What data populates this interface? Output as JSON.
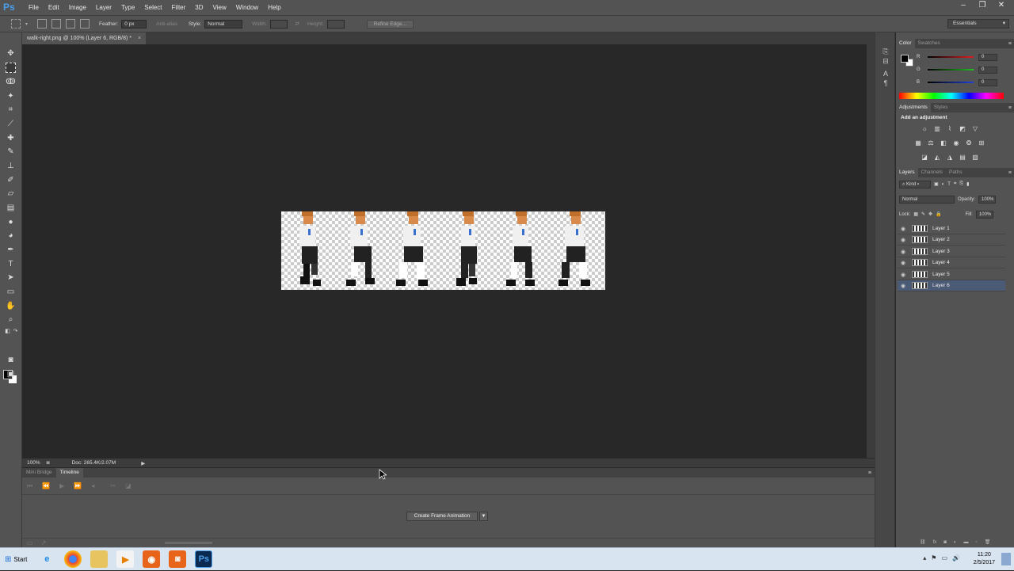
{
  "app": {
    "logo": "Ps"
  },
  "menu": [
    "File",
    "Edit",
    "Image",
    "Layer",
    "Type",
    "Select",
    "Filter",
    "3D",
    "View",
    "Window",
    "Help"
  ],
  "window_controls": {
    "minimize": "–",
    "restore": "❐",
    "close": "✕"
  },
  "options": {
    "feather_label": "Feather:",
    "feather_value": "0 px",
    "antialias_label": "Anti-alias",
    "style_label": "Style:",
    "style_value": "Normal",
    "width_label": "Width:",
    "height_label": "Height:",
    "refine_edge": "Refine Edge...",
    "workspace": "Essentials"
  },
  "document": {
    "tab_title": "walk-right.png @ 100% (Layer 6, RGB/8) *",
    "zoom": "100%",
    "doc_info": "Doc: 265.4K/2.07M"
  },
  "timeline": {
    "tabs": [
      "Mini Bridge",
      "Timeline"
    ],
    "active_tab": "Timeline",
    "create_button": "Create Frame Animation"
  },
  "color_panel": {
    "tabs": [
      "Color",
      "Swatches"
    ],
    "channels": [
      {
        "label": "R",
        "value": "0",
        "color": "#e02020"
      },
      {
        "label": "G",
        "value": "0",
        "color": "#20c020"
      },
      {
        "label": "B",
        "value": "0",
        "color": "#2040e0"
      }
    ]
  },
  "adjustments_panel": {
    "tabs": [
      "Adjustments",
      "Styles"
    ],
    "heading": "Add an adjustment"
  },
  "layers_panel": {
    "tabs": [
      "Layers",
      "Channels",
      "Paths"
    ],
    "kind": "Kind",
    "blend_mode": "Normal",
    "opacity_label": "Opacity:",
    "opacity_value": "100%",
    "lock_label": "Lock:",
    "fill_label": "Fill:",
    "fill_value": "100%",
    "layers": [
      {
        "name": "Layer 1",
        "selected": false
      },
      {
        "name": "Layer 2",
        "selected": false
      },
      {
        "name": "Layer 3",
        "selected": false
      },
      {
        "name": "Layer 4",
        "selected": false
      },
      {
        "name": "Layer 5",
        "selected": false
      },
      {
        "name": "Layer 6",
        "selected": true
      }
    ]
  },
  "taskbar": {
    "start": "Start",
    "time": "11:20",
    "date": "2/5/2017"
  }
}
